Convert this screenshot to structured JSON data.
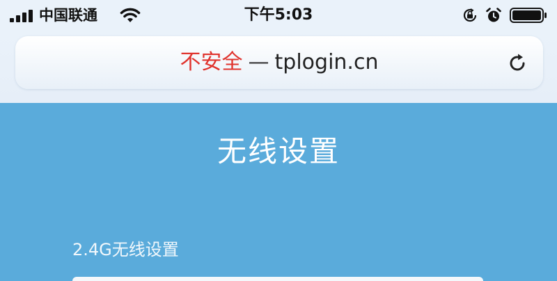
{
  "status_bar": {
    "carrier": "中国联通",
    "time": "下午5:03",
    "icons": [
      "signal-icon",
      "wifi-icon",
      "rotation-lock-icon",
      "alarm-icon",
      "battery-icon"
    ]
  },
  "address_bar": {
    "security_label": "不安全",
    "separator": "—",
    "domain": "tplogin.cn",
    "reload_icon": "reload-icon"
  },
  "page": {
    "title": "无线设置",
    "section_label": "2.4G无线设置"
  },
  "colors": {
    "page_background": "#5aabdb",
    "insecure": "#e0332d",
    "chrome_background": "#eaf2fa"
  }
}
